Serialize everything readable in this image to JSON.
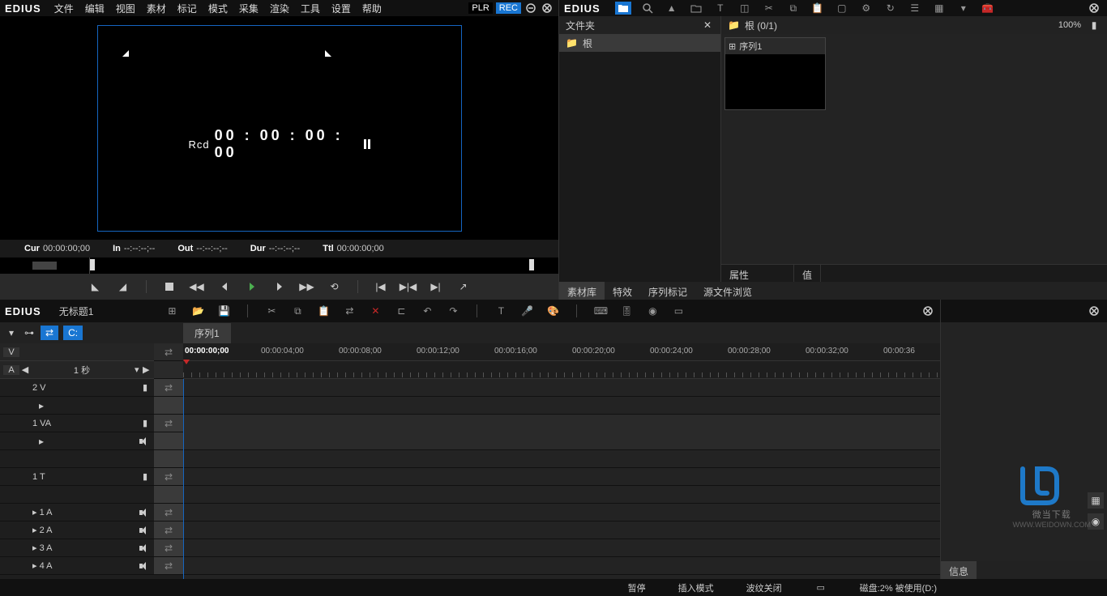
{
  "app": {
    "name": "EDIUS"
  },
  "menu": {
    "items": [
      "文件",
      "编辑",
      "视图",
      "素材",
      "标记",
      "模式",
      "采集",
      "渲染",
      "工具",
      "设置",
      "帮助"
    ],
    "plr": "PLR",
    "rec": "REC"
  },
  "preview": {
    "rcd_label": "Rcd",
    "rcd_tc": "00 : 00 : 00 : 00",
    "tc": {
      "cur_label": "Cur",
      "cur": "00:00:00;00",
      "in_label": "In",
      "in": "--:--:--;--",
      "out_label": "Out",
      "out": "--:--:--;--",
      "dur_label": "Dur",
      "dur": "--:--:--;--",
      "ttl_label": "Ttl",
      "ttl": "00:00:00;00"
    }
  },
  "bin": {
    "folder_header": "文件夹",
    "root_folder": "根",
    "content_header": "根 (0/1)",
    "zoom": "100%",
    "clip_name": "序列1",
    "prop_attr": "属性",
    "prop_val": "值",
    "tabs": [
      "素材库",
      "特效",
      "序列标记",
      "源文件浏览"
    ]
  },
  "timeline": {
    "title": "无标题1",
    "seq_tab": "序列1",
    "v_btn": "V",
    "a_btn": "A",
    "time_scale": "1 秒",
    "ruler_start": "00:00:00;00",
    "ticks": [
      "00:00:04;00",
      "00:00:08;00",
      "00:00:12;00",
      "00:00:16;00",
      "00:00:20;00",
      "00:00:24;00",
      "00:00:28;00",
      "00:00:32;00",
      "00:00:36"
    ],
    "tracks": {
      "v2": "2 V",
      "va1": "1 VA",
      "t1": "1 T",
      "a1": "1 A",
      "a2": "2 A",
      "a3": "3 A",
      "a4": "4 A"
    }
  },
  "side": {
    "info_tab": "信息"
  },
  "status": {
    "pause": "暂停",
    "insert_mode": "插入模式",
    "ripple": "波纹关闭",
    "disk": "磁盘:2% 被使用(D:)"
  },
  "watermark": {
    "name": "微当下载",
    "url": "WWW.WEIDOWN.COM"
  }
}
